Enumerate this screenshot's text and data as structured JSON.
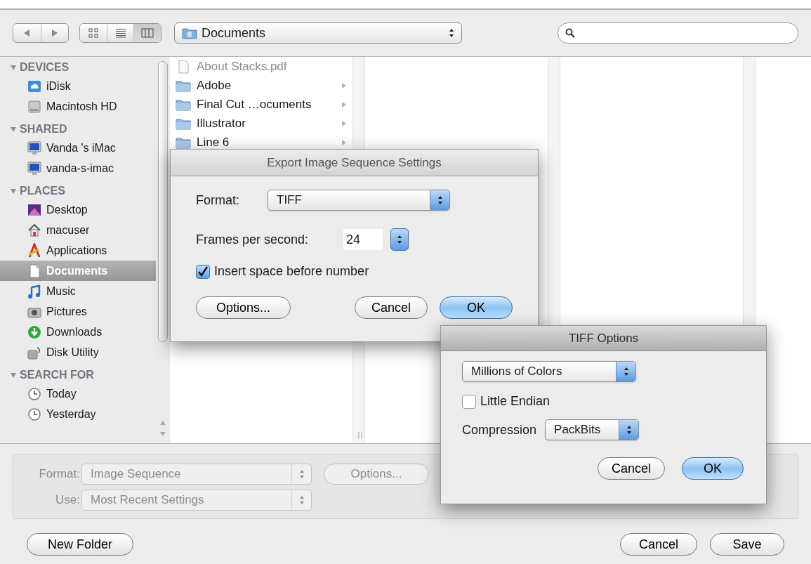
{
  "toolbar": {
    "views": [
      {
        "kind": "icons",
        "selected": false
      },
      {
        "kind": "list",
        "selected": false
      },
      {
        "kind": "columns",
        "selected": true
      }
    ],
    "path": {
      "value": "Documents"
    }
  },
  "sidebar": {
    "sections": [
      {
        "title": "DEVICES",
        "expanded": true,
        "items": [
          {
            "label": "iDisk",
            "kind": "idisk",
            "selected": false
          },
          {
            "label": "Macintosh HD",
            "kind": "hd",
            "selected": false
          }
        ]
      },
      {
        "title": "SHARED",
        "expanded": true,
        "items": [
          {
            "label": "Vanda 's iMac",
            "kind": "imac",
            "selected": false
          },
          {
            "label": "vanda-s-imac",
            "kind": "imac",
            "selected": false
          }
        ]
      },
      {
        "title": "PLACES",
        "expanded": true,
        "items": [
          {
            "label": "Desktop",
            "kind": "desktop",
            "selected": false
          },
          {
            "label": "macuser",
            "kind": "home",
            "selected": false
          },
          {
            "label": "Applications",
            "kind": "apps",
            "selected": false
          },
          {
            "label": "Documents",
            "kind": "documents",
            "selected": true
          },
          {
            "label": "Music",
            "kind": "music",
            "selected": false
          },
          {
            "label": "Pictures",
            "kind": "pictures",
            "selected": false
          },
          {
            "label": "Downloads",
            "kind": "downloads",
            "selected": false
          },
          {
            "label": "Disk Utility",
            "kind": "utility",
            "selected": false
          }
        ]
      },
      {
        "title": "SEARCH FOR",
        "expanded": true,
        "items": [
          {
            "label": "Today",
            "kind": "clock",
            "selected": false
          },
          {
            "label": "Yesterday",
            "kind": "clock",
            "selected": false
          }
        ]
      }
    ]
  },
  "browser_column": {
    "items": [
      {
        "label": "About Stacks.pdf",
        "kind": "file"
      },
      {
        "label": "Adobe",
        "kind": "folder"
      },
      {
        "label": "Final Cut …ocuments",
        "kind": "folder"
      },
      {
        "label": "Illustrator",
        "kind": "folder"
      },
      {
        "label": "Line 6",
        "kind": "folder"
      }
    ]
  },
  "save_panel": {
    "format": {
      "label": "Format:",
      "value": "Image Sequence",
      "disabled": true
    },
    "use": {
      "label": "Use:",
      "value": "Most Recent Settings",
      "disabled": true
    },
    "options_button": {
      "label": "Options...",
      "disabled": true
    },
    "new_folder": {
      "label": "New Folder"
    },
    "buttons": [
      {
        "label": "Cancel",
        "default": false
      },
      {
        "label": "Save",
        "default": false
      }
    ]
  },
  "export_dialog": {
    "title": "Export Image Sequence Settings",
    "format": {
      "label": "Format:",
      "value": "TIFF"
    },
    "fps": {
      "label": "Frames per second:",
      "value": "24"
    },
    "insert_space": {
      "label": "Insert space before number",
      "checked": true
    },
    "buttons": [
      {
        "label": "Options...",
        "default": false
      },
      {
        "label": "Cancel",
        "default": false
      },
      {
        "label": "OK",
        "default": true
      }
    ]
  },
  "tiff_dialog": {
    "title": "TIFF Options",
    "depth": {
      "value": "Millions of Colors"
    },
    "little_endian": {
      "label": "Little Endian",
      "checked": false
    },
    "compression": {
      "label": "Compression",
      "value": "PackBits"
    },
    "buttons": [
      {
        "label": "Cancel",
        "default": false
      },
      {
        "label": "OK",
        "default": true
      }
    ]
  }
}
